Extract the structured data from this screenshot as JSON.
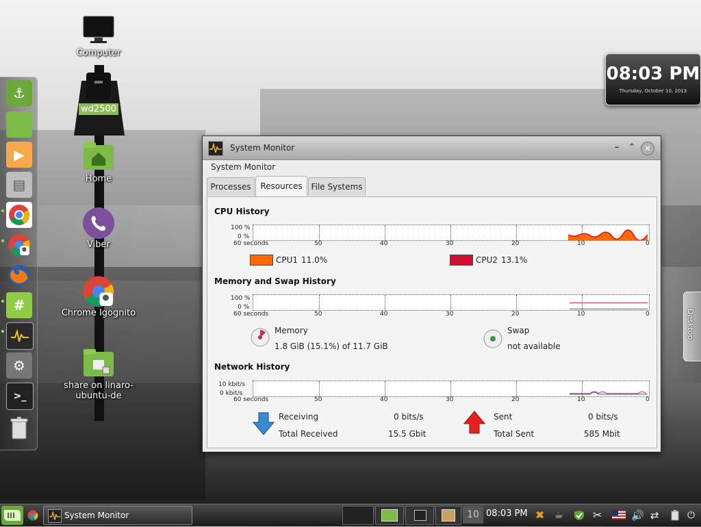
{
  "desktop": {
    "icons": [
      {
        "label": "Computer"
      },
      {
        "label": "wd2500"
      },
      {
        "label": "Home"
      },
      {
        "label": "Viber"
      },
      {
        "label": "Chrome Igognito"
      },
      {
        "label": "share on linaro-ubuntu-de"
      }
    ],
    "clock": {
      "time": "08:03 PM",
      "date": "Thursday, October 10, 2013"
    },
    "right_tab": "Desktop"
  },
  "window": {
    "title": "System Monitor",
    "app_title": "System Monitor",
    "tabs": [
      {
        "label": "Processes",
        "active": false
      },
      {
        "label": "Resources",
        "active": true
      },
      {
        "label": "File Systems",
        "active": false
      }
    ],
    "cpu": {
      "title": "CPU History",
      "y_top": "100 %",
      "y_bottom": "0 %",
      "x_labels": [
        "60 seconds",
        "50",
        "40",
        "30",
        "20",
        "10",
        "0"
      ],
      "cpu1_label": "CPU1",
      "cpu1_value": "11.0%",
      "cpu1_color": "#ff6a00",
      "cpu2_label": "CPU2",
      "cpu2_value": "13.1%",
      "cpu2_color": "#d01030"
    },
    "memory": {
      "title": "Memory and Swap History",
      "y_top": "100 %",
      "y_bottom": "0 %",
      "x_labels": [
        "60 seconds",
        "50",
        "40",
        "30",
        "20",
        "10",
        "0"
      ],
      "memory_label": "Memory",
      "memory_value": "1.8 GiB (15.1%) of 11.7 GiB",
      "swap_label": "Swap",
      "swap_value": "not available"
    },
    "network": {
      "title": "Network History",
      "y_top": "10 kbit/s",
      "y_bottom": "0 kbit/s",
      "x_labels": [
        "60 seconds",
        "50",
        "40",
        "30",
        "20",
        "10",
        "0"
      ],
      "receiving_label": "Receiving",
      "receiving_value": "0 bits/s",
      "total_received_label": "Total Received",
      "total_received_value": "15.5 Gbit",
      "sent_label": "Sent",
      "sent_value": "0 bits/s",
      "total_sent_label": "Total Sent",
      "total_sent_value": "585 Mbit"
    }
  },
  "taskbar": {
    "task_label": "System Monitor",
    "clock": "08:03 PM"
  }
}
